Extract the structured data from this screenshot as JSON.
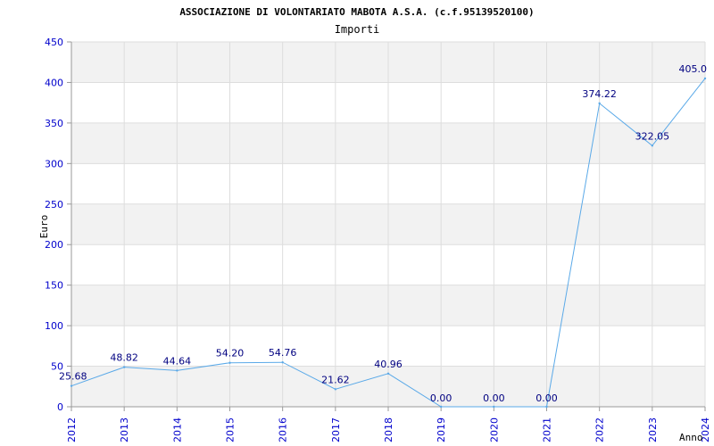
{
  "chart_data": {
    "type": "line",
    "title": "ASSOCIAZIONE DI VOLONTARIATO MABOTA A.S.A. (c.f.95139520100)",
    "subtitle": "Importi",
    "ylabel": "Euro",
    "xlabel": "Anno",
    "ylim": [
      0,
      450
    ],
    "yticks": [
      0,
      50,
      100,
      150,
      200,
      250,
      300,
      350,
      400,
      450
    ],
    "categories": [
      "2012",
      "2013",
      "2014",
      "2015",
      "2016",
      "2017",
      "2018",
      "2019",
      "2020",
      "2021",
      "2022",
      "2023",
      "2024"
    ],
    "values": [
      25.68,
      48.82,
      44.64,
      54.2,
      54.76,
      21.62,
      40.96,
      0.0,
      0.0,
      0.0,
      374.22,
      322.05,
      405.0
    ],
    "value_labels": [
      "25.68",
      "48.82",
      "44.64",
      "54.20",
      "54.76",
      "21.62",
      "40.96",
      "0.00",
      "0.00",
      "0.00",
      "374.22",
      "322.05",
      "405.0"
    ],
    "grid": true,
    "colors": {
      "line": "#5aa9e8",
      "band": "#f2f2f2",
      "tick": "#0000cc",
      "label": "#000080"
    }
  }
}
